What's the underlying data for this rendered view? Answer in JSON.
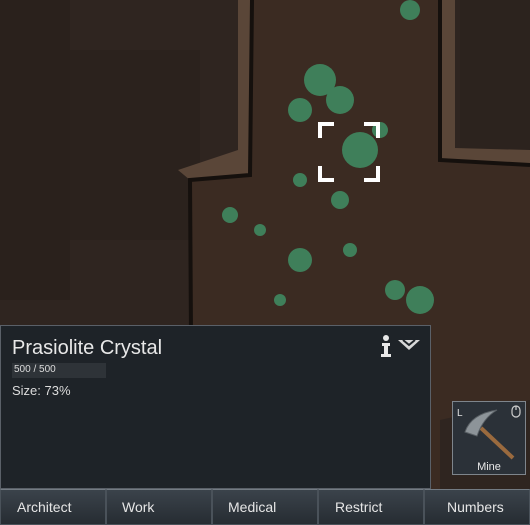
{
  "inspect_pane": {
    "title": "Prasiolite Crystal",
    "hit_points_text": "500 / 500",
    "hit_points_fraction": 1.0,
    "size_text": "Size: 73%",
    "info_icon": "info-icon",
    "collapse_icon": "chevron-down-icon"
  },
  "gizmo": {
    "label": "Mine",
    "hotkey": "L",
    "icon": "pickaxe-icon",
    "mouse_icon": "mouse-icon"
  },
  "main_tabs": [
    {
      "label": "Architect"
    },
    {
      "label": "Work"
    },
    {
      "label": "Medical"
    },
    {
      "label": "Restrict"
    },
    {
      "label": "Numbers"
    }
  ],
  "colors": {
    "rock": "#2f2520",
    "soil": "#3b2b22",
    "crystal": "#3f7f5a",
    "panel": "#1e2328",
    "selection": "#ffffff"
  }
}
